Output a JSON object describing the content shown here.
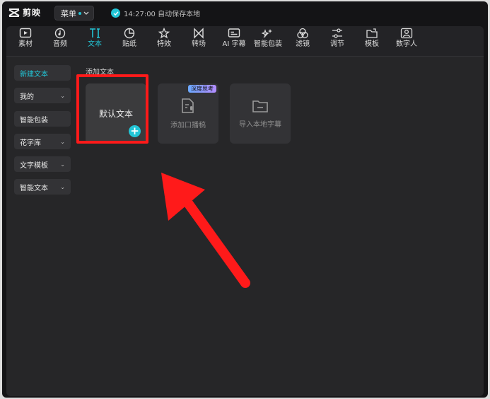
{
  "app": {
    "name": "剪映",
    "menu_label": "菜单",
    "save_status": "14:27:00 自动保存本地"
  },
  "toolbar": {
    "items": [
      {
        "label": "素材",
        "icon": "media-icon"
      },
      {
        "label": "音频",
        "icon": "audio-icon"
      },
      {
        "label": "文本",
        "icon": "text-icon",
        "active": true
      },
      {
        "label": "贴纸",
        "icon": "sticker-icon"
      },
      {
        "label": "特效",
        "icon": "effects-icon"
      },
      {
        "label": "转场",
        "icon": "transition-icon"
      },
      {
        "label": "AI 字幕",
        "icon": "ai-caption-icon"
      },
      {
        "label": "智能包装",
        "icon": "smart-pack-icon"
      },
      {
        "label": "滤镜",
        "icon": "filter-icon"
      },
      {
        "label": "调节",
        "icon": "adjust-icon"
      },
      {
        "label": "模板",
        "icon": "template-icon"
      },
      {
        "label": "数字人",
        "icon": "digital-human-icon"
      }
    ]
  },
  "sidebar": {
    "items": [
      {
        "label": "新建文本",
        "active": true
      },
      {
        "label": "我的",
        "dropdown": true
      },
      {
        "label": "智能包装"
      },
      {
        "label": "花字库",
        "dropdown": true
      },
      {
        "label": "文字模板",
        "dropdown": true
      },
      {
        "label": "智能文本",
        "dropdown": true
      }
    ]
  },
  "main": {
    "section_title": "添加文本",
    "cards": [
      {
        "label": "默认文本"
      },
      {
        "label": "添加口播稿",
        "badge": "深度思考"
      },
      {
        "label": "导入本地字幕"
      }
    ]
  },
  "colors": {
    "accent": "#22c5d6",
    "annotation": "#ff1a1a"
  }
}
